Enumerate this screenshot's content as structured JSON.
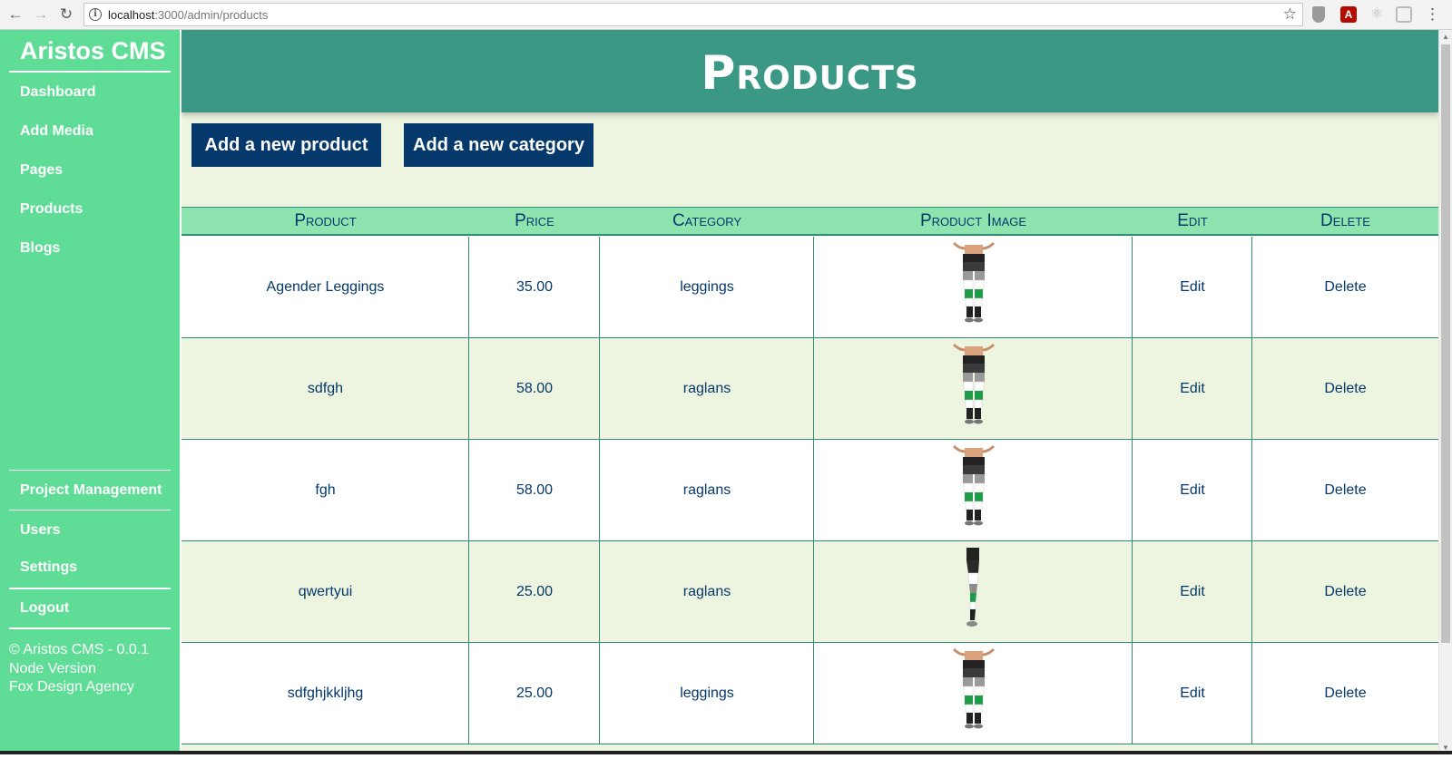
{
  "browser": {
    "url_host": "localhost",
    "url_path": ":3000/admin/products",
    "back_icon": "arrow-left-icon",
    "forward_icon": "arrow-right-icon",
    "reload_icon": "reload-icon"
  },
  "sidebar": {
    "brand": "Aristos CMS",
    "items": [
      {
        "label": "Dashboard"
      },
      {
        "label": "Add Media"
      },
      {
        "label": "Pages"
      },
      {
        "label": "Products"
      },
      {
        "label": "Blogs"
      }
    ],
    "bottom_items": [
      {
        "label": "Project Management"
      },
      {
        "label": "Users"
      },
      {
        "label": "Settings"
      },
      {
        "label": "Logout"
      }
    ],
    "footer": {
      "copyright": "© Aristos CMS - 0.0.1",
      "node": "Node Version",
      "agency": "Fox Design Agency"
    }
  },
  "main": {
    "title": "Products",
    "buttons": {
      "add_product": "Add a new product",
      "add_category": "Add a new category"
    },
    "table": {
      "headers": [
        "Product",
        "Price",
        "Category",
        "Product Image",
        "Edit",
        "Delete"
      ],
      "rows": [
        {
          "product": "Agender Leggings",
          "price": "35.00",
          "category": "leggings",
          "image": "leggings-front",
          "edit": "Edit",
          "delete": "Delete"
        },
        {
          "product": "sdfgh",
          "price": "58.00",
          "category": "raglans",
          "image": "leggings-front",
          "edit": "Edit",
          "delete": "Delete"
        },
        {
          "product": "fgh",
          "price": "58.00",
          "category": "raglans",
          "image": "leggings-front",
          "edit": "Edit",
          "delete": "Delete"
        },
        {
          "product": "qwertyui",
          "price": "25.00",
          "category": "raglans",
          "image": "leggings-side",
          "edit": "Edit",
          "delete": "Delete"
        },
        {
          "product": "sdfghjkkljhg",
          "price": "25.00",
          "category": "leggings",
          "image": "leggings-front",
          "edit": "Edit",
          "delete": "Delete"
        }
      ]
    }
  },
  "colors": {
    "sidebar": "#5fdd97",
    "hero": "#3a9884",
    "button": "#05386b",
    "table_header": "#8ee4af",
    "row_alt": "#edf5e1",
    "text": "#05386b"
  }
}
